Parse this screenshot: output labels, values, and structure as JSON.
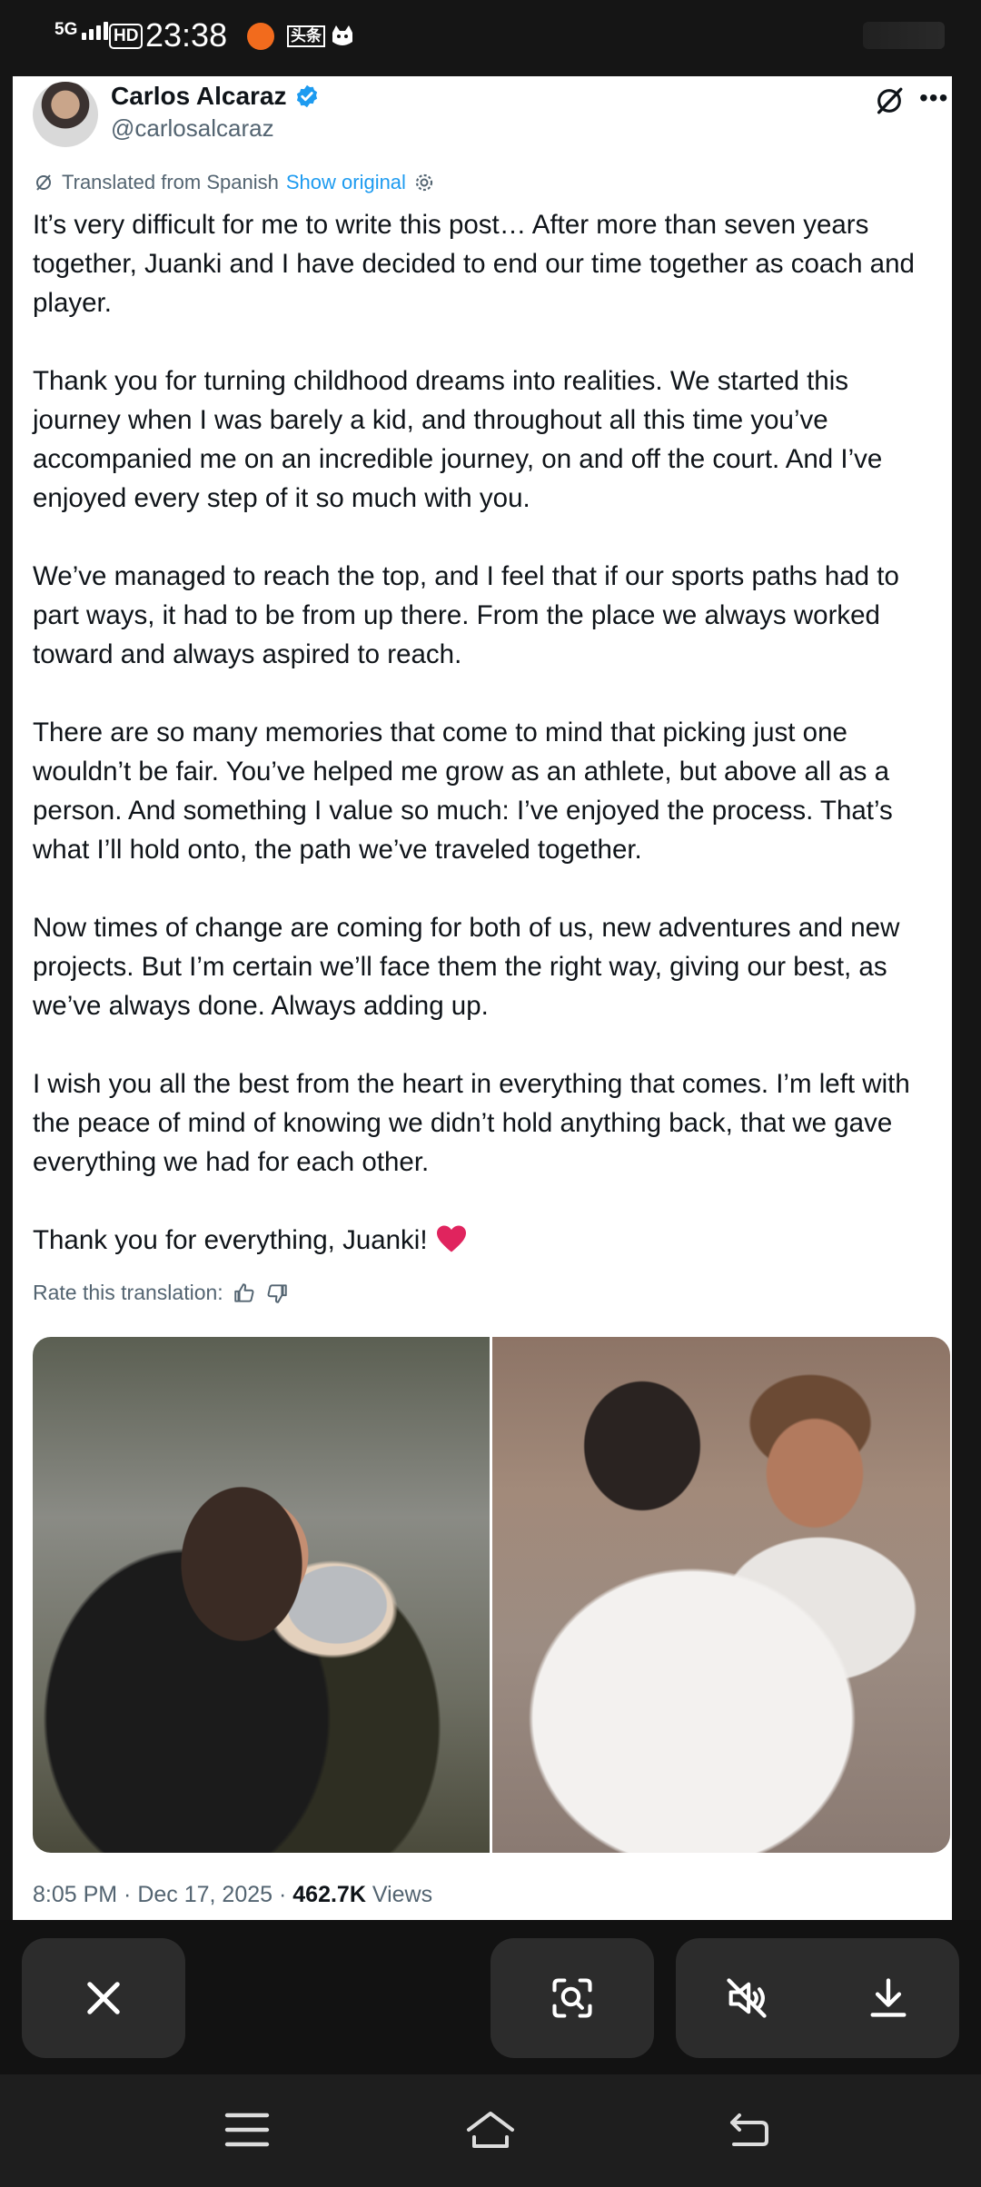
{
  "status_bar": {
    "network": "5G",
    "hd": "HD",
    "time": "23:38",
    "app2": "头条"
  },
  "tweet": {
    "author_name": "Carlos Alcaraz",
    "handle": "@carlosalcaraz",
    "translated_label": "Translated from Spanish",
    "show_original": "Show original",
    "paragraphs": [
      "It’s very difficult for me to write this post… After more than seven years together, Juanki and I have decided to end our time together as coach and player.",
      "Thank you for turning childhood dreams into realities. We started this journey when I was barely a kid, and throughout all this time you’ve accompanied me on an incredible journey, on and off the court. And I’ve enjoyed every step of it so much with you.",
      "We’ve managed to reach the top, and I feel that if our sports paths had to part ways, it had to be from up there. From the place we always worked toward and always aspired to reach.",
      "There are so many memories that come to mind that picking just one wouldn’t be fair. You’ve helped me grow as an athlete, but above all as a person. And something I value so much: I’ve enjoyed the process. That’s what I’ll hold onto, the path we’ve traveled together.",
      "Now times of change are coming for both of us, new adventures and new projects. But I’m certain we’ll face them the right way, giving our best, as we’ve always done. Always adding up.",
      "I wish you all the best from the heart in everything that comes. I’m left with the peace of mind of knowing we didn’t hold anything back, that we gave everything we had for each other.",
      "Thank you for everything, Juanki!"
    ],
    "rate_label": "Rate this translation:",
    "time": "8:05 PM",
    "date": "Dec 17, 2025",
    "views_count": "462.7K",
    "views_label": "Views"
  },
  "colors": {
    "accent": "#1d9bf0",
    "heart": "#e0245e",
    "text": "#0f1419",
    "muted": "#536471"
  },
  "icons": {
    "verified": "verified-badge-icon",
    "grok": "grok-icon",
    "more": "more-icon",
    "close": "close-icon",
    "scan": "image-search-icon",
    "mute": "mute-icon",
    "download": "download-icon"
  }
}
